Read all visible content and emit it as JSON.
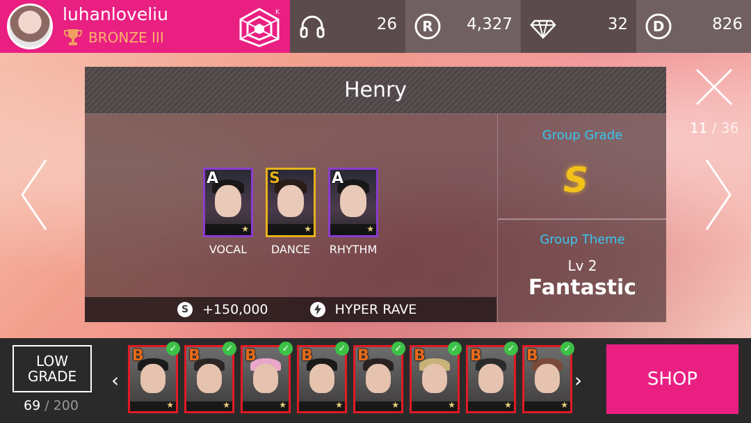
{
  "profile": {
    "username": "luhanloveliu",
    "rank": "BRONZE III",
    "logo_badge": "K"
  },
  "stats": [
    {
      "icon": "headphones-icon",
      "value": "26"
    },
    {
      "icon": "r-coin-icon",
      "value": "4,327"
    },
    {
      "icon": "diamond-icon",
      "value": "32"
    },
    {
      "icon": "d-coin-icon",
      "value": "826"
    }
  ],
  "panel": {
    "title": "Henry",
    "members": [
      {
        "grade": "A",
        "role": "VOCAL",
        "frame": "purple"
      },
      {
        "grade": "S",
        "role": "DANCE",
        "frame": "gold"
      },
      {
        "grade": "A",
        "role": "RHYTHM",
        "frame": "purple"
      }
    ],
    "bonus": {
      "coin_symbol": "S",
      "score": "+150,000",
      "skill": "HYPER RAVE"
    },
    "group_grade_label": "Group Grade",
    "group_grade": "S",
    "group_theme_label": "Group Theme",
    "theme_level": "Lv 2",
    "theme_name": "Fantastic"
  },
  "pager": {
    "current": "11",
    "separator": " / ",
    "total": "36"
  },
  "inventory": {
    "filter_label_line1": "LOW",
    "filter_label_line2": "GRADE",
    "count": "69",
    "separator": " / ",
    "capacity": "200",
    "cards": [
      {
        "grade": "B",
        "checked": true
      },
      {
        "grade": "B",
        "checked": true
      },
      {
        "grade": "B",
        "checked": true
      },
      {
        "grade": "B",
        "checked": true
      },
      {
        "grade": "B",
        "checked": true
      },
      {
        "grade": "B",
        "checked": true
      },
      {
        "grade": "B",
        "checked": true
      },
      {
        "grade": "B",
        "checked": true
      }
    ]
  },
  "shop_label": "SHOP",
  "colors": {
    "brand_pink": "#ea1f82",
    "rank_orange": "#ffb36b",
    "label_cyan": "#38c7f0",
    "grade_gold": "#f2c21a",
    "check_green": "#3cc247"
  }
}
